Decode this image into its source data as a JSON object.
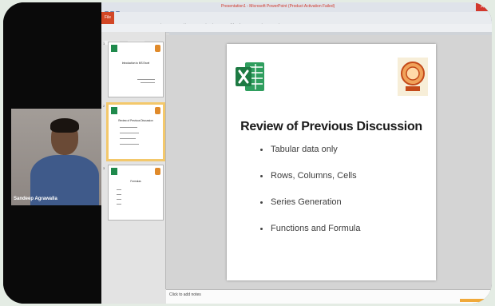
{
  "video": {
    "participant_name": "Sandeep Agrawalla",
    "tile_bg": "#9a938f"
  },
  "app": {
    "window_title": "Presentation1 - Microsoft PowerPoint (Product Activation Failed)",
    "file_tab": "File",
    "ribbon_tabs": [
      "Home",
      "Insert",
      "Design",
      "Transitions",
      "Animations",
      "Slide Show",
      "Review",
      "View"
    ],
    "pane_tabs": [
      "Slides",
      "Outline"
    ],
    "notes_placeholder": "Click to add notes",
    "accent": "#d24726",
    "close_label": "✕"
  },
  "thumbnails": [
    {
      "num": "1",
      "title": "Introduction to MS Excel",
      "active": false
    },
    {
      "num": "2",
      "title": "Review of Previous Discussion",
      "active": true
    },
    {
      "num": "3",
      "title": "Formulas",
      "active": false
    }
  ],
  "slide": {
    "title": "Review of Previous Discussion",
    "bullets": [
      "Tabular data only",
      "Rows, Columns, Cells",
      "Series Generation",
      "Functions and Formula"
    ],
    "excel_icon_color": "#1f8a4c",
    "logo_color": "#d9561e"
  }
}
